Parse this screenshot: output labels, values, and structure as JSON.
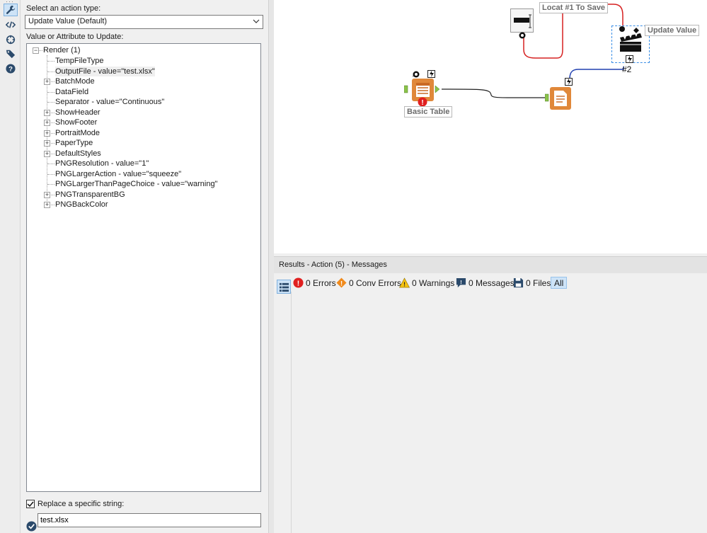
{
  "config": {
    "action_type_label": "Select an action type:",
    "action_type_value": "Update Value (Default)",
    "value_label": "Value or Attribute to Update:",
    "tree": {
      "root": "Render (1)",
      "items": [
        {
          "label": "TempFileType",
          "expandable": false
        },
        {
          "label": "OutputFile - value=\"test.xlsx\"",
          "expandable": false,
          "selected": true
        },
        {
          "label": "BatchMode",
          "expandable": true
        },
        {
          "label": "DataField",
          "expandable": false
        },
        {
          "label": "Separator - value=\"Continuous\"",
          "expandable": false
        },
        {
          "label": "ShowHeader",
          "expandable": true
        },
        {
          "label": "ShowFooter",
          "expandable": true
        },
        {
          "label": "PortraitMode",
          "expandable": true
        },
        {
          "label": "PaperType",
          "expandable": true
        },
        {
          "label": "DefaultStyles",
          "expandable": true
        },
        {
          "label": "PNGResolution - value=\"1\"",
          "expandable": false
        },
        {
          "label": "PNGLargerAction - value=\"squeeze\"",
          "expandable": false
        },
        {
          "label": "PNGLargerThanPageChoice - value=\"warning\"",
          "expandable": false
        },
        {
          "label": "PNGTransparentBG",
          "expandable": true
        },
        {
          "label": "PNGBackColor",
          "expandable": true
        }
      ]
    },
    "replace_label": "Replace a specific string:",
    "replace_checked": true,
    "replace_value": "test.xlsx"
  },
  "canvas": {
    "tools": {
      "basic_table": {
        "label": "Basic Table"
      },
      "text_box": {
        "label": "Locat #1 To Save"
      },
      "action": {
        "label": "Update Value",
        "connection": "#2"
      }
    }
  },
  "results": {
    "header": "Results - Action (5) - Messages",
    "filters": {
      "errors": "0 Errors",
      "conv_errors": "0 Conv Errors",
      "warnings": "0 Warnings",
      "messages": "0 Messages",
      "files": "0 Files",
      "all": "All"
    }
  },
  "colors": {
    "tool_orange": "#e0883a",
    "wire_red": "#d62020",
    "wire_blue": "#2040b0",
    "error_red": "#e02020",
    "selection_blue": "#cde3f7"
  }
}
